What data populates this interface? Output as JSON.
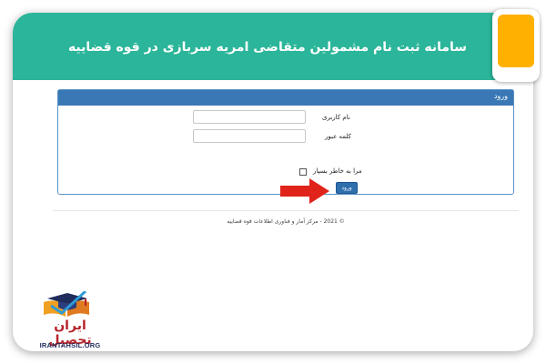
{
  "header": {
    "title": "سامانه ثبت نام مشمولین متقاضی امریه سربازی در قوه قضاییه",
    "color": "#2bb59a"
  },
  "login_panel": {
    "heading": "ورود",
    "username_label": "نام کاربری",
    "username_value": "",
    "password_label": "کلمه عبور",
    "password_value": "",
    "remember_label": "مرا به خاطر بسپار",
    "remember_checked": false,
    "submit_label": "ورود",
    "accent_color": "#3a78b5"
  },
  "footer": {
    "text": "© 2021 - مرکز آمار و فناوری اطلاعات قوه قضاییه"
  },
  "watermark": {
    "brand": "ایران تحصیل",
    "url": "IRANTAHSIL.ORG",
    "brand_color": "#b5232a"
  },
  "icons": {
    "arrow": "right-arrow-icon",
    "logo": "graduation-cap-book-icon"
  },
  "corner_tab_color": "#ffb000"
}
